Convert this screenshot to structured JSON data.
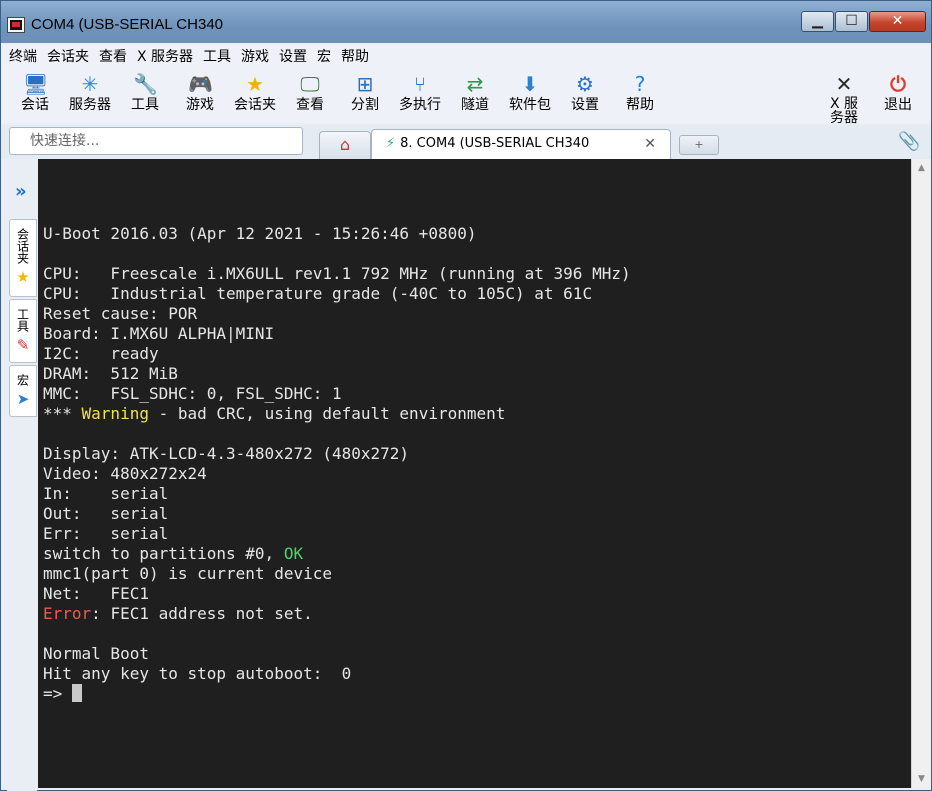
{
  "window": {
    "title": "COM4  (USB-SERIAL CH340",
    "minimize": "▁",
    "maximize": "☐",
    "close": "✕"
  },
  "menu": [
    "终端",
    "会话夹",
    "查看",
    "X 服务器",
    "工具",
    "游戏",
    "设置",
    "宏",
    "帮助"
  ],
  "toolbar": [
    {
      "label": "会话",
      "icon": "session-icon",
      "glyph": "🖥"
    },
    {
      "label": "服务器",
      "icon": "servers-icon",
      "glyph": "✳"
    },
    {
      "label": "工具",
      "icon": "tools-icon",
      "glyph": "🔧"
    },
    {
      "label": "游戏",
      "icon": "games-icon",
      "glyph": "🎮"
    },
    {
      "label": "会话夹",
      "icon": "star-icon",
      "glyph": "★"
    },
    {
      "label": "查看",
      "icon": "view-icon",
      "glyph": "🖵"
    },
    {
      "label": "分割",
      "icon": "split-icon",
      "glyph": "⊞"
    },
    {
      "label": "多执行",
      "icon": "multiexec-icon",
      "glyph": "⑂"
    },
    {
      "label": "隧道",
      "icon": "tunnel-icon",
      "glyph": "⇄"
    },
    {
      "label": "软件包",
      "icon": "packages-icon",
      "glyph": "⬇"
    },
    {
      "label": "设置",
      "icon": "settings-icon",
      "glyph": "⚙"
    },
    {
      "label": "帮助",
      "icon": "help-icon",
      "glyph": "?"
    }
  ],
  "toolbar_right": [
    {
      "label": "X 服务器",
      "icon": "x-server-icon",
      "glyph": "✕"
    },
    {
      "label": "退出",
      "icon": "power-icon",
      "glyph": "⏻"
    }
  ],
  "quick_connect": {
    "placeholder": "快速连接..."
  },
  "tabs": {
    "active_label": "8. COM4  (USB-SERIAL CH340",
    "close": "✕",
    "new": "+"
  },
  "side_tabs": [
    "会话夹",
    "工具",
    "宏"
  ],
  "colors": {
    "terminal_bg": "#1f1f1f",
    "warning": "#f2e24a",
    "ok": "#4fcf71",
    "error": "#f05a4a"
  },
  "terminal": {
    "lines": [
      [
        {
          "t": ""
        }
      ],
      [
        {
          "t": "U-Boot 2016.03 (Apr 12 2021 - 15:26:46 +0800)"
        }
      ],
      [
        {
          "t": ""
        }
      ],
      [
        {
          "t": "CPU:   Freescale i.MX6ULL rev1.1 792 MHz (running at 396 MHz)"
        }
      ],
      [
        {
          "t": "CPU:   Industrial temperature grade (-40C to 105C) at 61C"
        }
      ],
      [
        {
          "t": "Reset cause: POR"
        }
      ],
      [
        {
          "t": "Board: I.MX6U ALPHA|MINI"
        }
      ],
      [
        {
          "t": "I2C:   ready"
        }
      ],
      [
        {
          "t": "DRAM:  512 MiB"
        }
      ],
      [
        {
          "t": "MMC:   FSL_SDHC: 0, FSL_SDHC: 1"
        }
      ],
      [
        {
          "t": "*** "
        },
        {
          "t": "Warning",
          "c": "warn"
        },
        {
          "t": " - bad CRC, using default environment"
        }
      ],
      [
        {
          "t": ""
        }
      ],
      [
        {
          "t": "Display: ATK-LCD-4.3-480x272 (480x272)"
        }
      ],
      [
        {
          "t": "Video: 480x272x24"
        }
      ],
      [
        {
          "t": "In:    serial"
        }
      ],
      [
        {
          "t": "Out:   serial"
        }
      ],
      [
        {
          "t": "Err:   serial"
        }
      ],
      [
        {
          "t": "switch to partitions #0, "
        },
        {
          "t": "OK",
          "c": "ok"
        }
      ],
      [
        {
          "t": "mmc1(part 0) is current device"
        }
      ],
      [
        {
          "t": "Net:   FEC1"
        }
      ],
      [
        {
          "t": "Error",
          "c": "err"
        },
        {
          "t": ": FEC1 address not set."
        }
      ],
      [
        {
          "t": ""
        }
      ],
      [
        {
          "t": "Normal Boot"
        }
      ],
      [
        {
          "t": "Hit any key to stop autoboot:  0"
        }
      ],
      [
        {
          "t": "=> "
        },
        {
          "cursor": true
        }
      ]
    ]
  }
}
